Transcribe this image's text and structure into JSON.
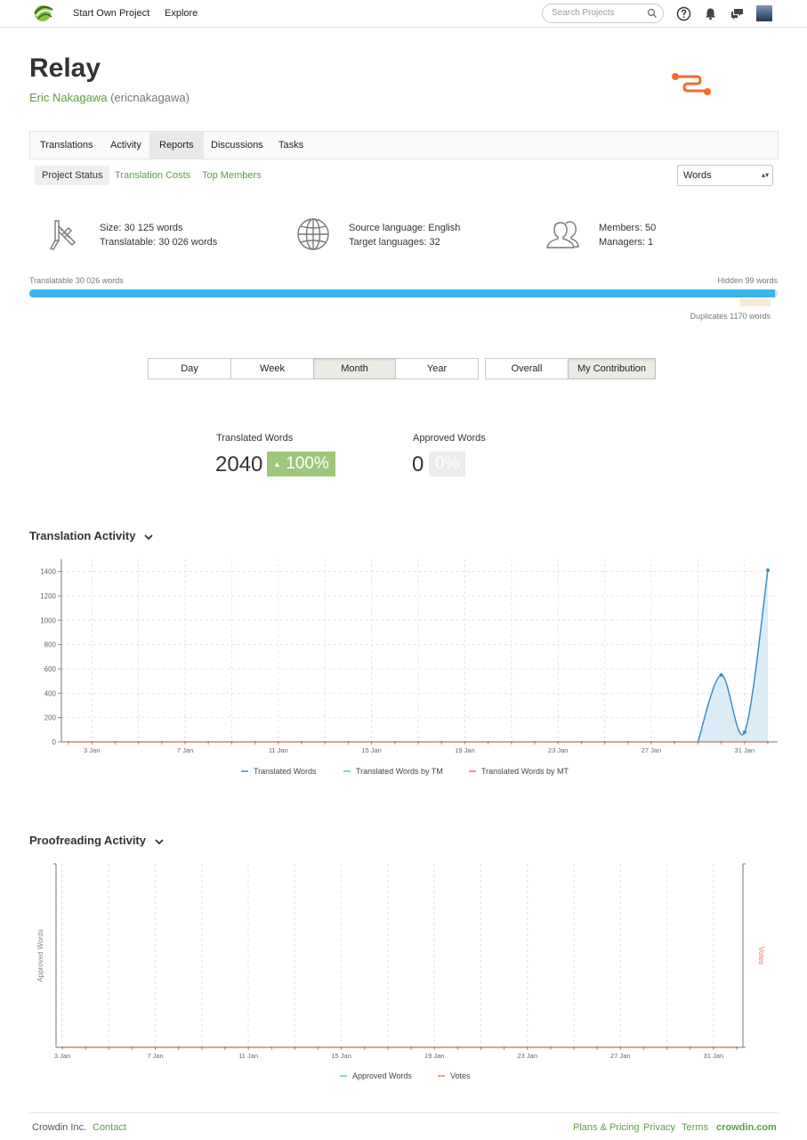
{
  "nav": {
    "start_project": "Start Own Project",
    "explore": "Explore",
    "search_placeholder": "Search Projects"
  },
  "project": {
    "title": "Relay",
    "owner_name": "Eric Nakagawa",
    "owner_handle": "(ericnakagawa)"
  },
  "tabs": [
    "Translations",
    "Activity",
    "Reports",
    "Discussions",
    "Tasks"
  ],
  "active_tab": "Reports",
  "subtabs": [
    "Project Status",
    "Translation Costs",
    "Top Members"
  ],
  "active_subtab": "Project Status",
  "unit_select": "Words",
  "stats": {
    "size": "Size: 30 125 words",
    "translatable": "Translatable: 30 026 words",
    "source_language": "Source language: English",
    "target_languages": "Target languages: 32",
    "members": "Members: 50",
    "managers": "Managers: 1"
  },
  "progress": {
    "translatable_label": "Translatable 30 026 words",
    "hidden_label": "Hidden 99 words",
    "duplicates_label": "Duplicates 1170 words",
    "translatable_fraction": 0.9967
  },
  "periods": [
    "Day",
    "Week",
    "Month",
    "Year"
  ],
  "active_period": "Month",
  "scopes": [
    "Overall",
    "My Contribution"
  ],
  "active_scope": "My Contribution",
  "summary": {
    "translated_label": "Translated Words",
    "translated_value": "2040",
    "translated_change": "100%",
    "approved_label": "Approved Words",
    "approved_value": "0",
    "approved_change": "0%"
  },
  "translation_activity": {
    "title": "Translation Activity"
  },
  "proofreading_activity": {
    "title": "Proofreading Activity"
  },
  "chart_data": [
    {
      "type": "area",
      "title": "Translation Activity",
      "xlabel": "",
      "ylabel": "",
      "x": [
        "2 Jan",
        "3 Jan",
        "4 Jan",
        "5 Jan",
        "6 Jan",
        "7 Jan",
        "8 Jan",
        "9 Jan",
        "10 Jan",
        "11 Jan",
        "12 Jan",
        "13 Jan",
        "14 Jan",
        "15 Jan",
        "16 Jan",
        "17 Jan",
        "18 Jan",
        "19 Jan",
        "20 Jan",
        "21 Jan",
        "22 Jan",
        "23 Jan",
        "24 Jan",
        "25 Jan",
        "26 Jan",
        "27 Jan",
        "28 Jan",
        "29 Jan",
        "30 Jan",
        "31 Jan",
        "1 Feb"
      ],
      "x_ticks": [
        "3 Jan",
        "7 Jan",
        "11 Jan",
        "15 Jan",
        "19 Jan",
        "23 Jan",
        "27 Jan",
        "31 Jan"
      ],
      "y_ticks": [
        0,
        200,
        400,
        600,
        800,
        1000,
        1200,
        1400
      ],
      "ylim": [
        0,
        1500
      ],
      "grid": true,
      "legend_position": "bottom",
      "series": [
        {
          "name": "Translated Words",
          "color": "#3a8fc9",
          "values": [
            0,
            0,
            0,
            0,
            0,
            0,
            0,
            0,
            0,
            0,
            0,
            0,
            0,
            0,
            0,
            0,
            0,
            0,
            0,
            0,
            0,
            0,
            0,
            0,
            0,
            0,
            0,
            0,
            550,
            80,
            1410
          ]
        },
        {
          "name": "Translated Words by TM",
          "color": "#5fc2d6",
          "values": [
            0,
            0,
            0,
            0,
            0,
            0,
            0,
            0,
            0,
            0,
            0,
            0,
            0,
            0,
            0,
            0,
            0,
            0,
            0,
            0,
            0,
            0,
            0,
            0,
            0,
            0,
            0,
            0,
            0,
            0,
            0
          ]
        },
        {
          "name": "Translated Words by MT",
          "color": "#e8745a",
          "values": [
            0,
            0,
            0,
            0,
            0,
            0,
            0,
            0,
            0,
            0,
            0,
            0,
            0,
            0,
            0,
            0,
            0,
            0,
            0,
            0,
            0,
            0,
            0,
            0,
            0,
            0,
            0,
            0,
            0,
            0,
            0
          ]
        }
      ]
    },
    {
      "type": "line",
      "title": "Proofreading Activity",
      "ylabel": "Approved Words",
      "y2label": "Votes",
      "x": [
        "3 Jan",
        "4 Jan",
        "5 Jan",
        "6 Jan",
        "7 Jan",
        "8 Jan",
        "9 Jan",
        "10 Jan",
        "11 Jan",
        "12 Jan",
        "13 Jan",
        "14 Jan",
        "15 Jan",
        "16 Jan",
        "17 Jan",
        "18 Jan",
        "19 Jan",
        "20 Jan",
        "21 Jan",
        "22 Jan",
        "23 Jan",
        "24 Jan",
        "25 Jan",
        "26 Jan",
        "27 Jan",
        "28 Jan",
        "29 Jan",
        "30 Jan",
        "31 Jan",
        "1 Feb"
      ],
      "x_ticks": [
        "3 Jan",
        "7 Jan",
        "11 Jan",
        "15 Jan",
        "19 Jan",
        "23 Jan",
        "27 Jan",
        "31 Jan"
      ],
      "grid": true,
      "legend_position": "bottom",
      "series": [
        {
          "name": "Approved Words",
          "color": "#5fc2d6",
          "values": [
            0,
            0,
            0,
            0,
            0,
            0,
            0,
            0,
            0,
            0,
            0,
            0,
            0,
            0,
            0,
            0,
            0,
            0,
            0,
            0,
            0,
            0,
            0,
            0,
            0,
            0,
            0,
            0,
            0,
            0
          ]
        },
        {
          "name": "Votes",
          "color": "#e8745a",
          "values": [
            0,
            0,
            0,
            0,
            0,
            0,
            0,
            0,
            0,
            0,
            0,
            0,
            0,
            0,
            0,
            0,
            0,
            0,
            0,
            0,
            0,
            0,
            0,
            0,
            0,
            0,
            0,
            0,
            0,
            0
          ]
        }
      ]
    }
  ],
  "footer": {
    "company": "Crowdin Inc.",
    "contact": "Contact",
    "plans": "Plans & Pricing",
    "privacy": "Privacy",
    "terms": "Terms",
    "site": "crowdin.com"
  },
  "colors": {
    "brand_green": "#5b9e44",
    "progress_blue": "#3cb4f0",
    "badge_green": "#9dc77b",
    "relay_orange": "#f26b2a"
  }
}
